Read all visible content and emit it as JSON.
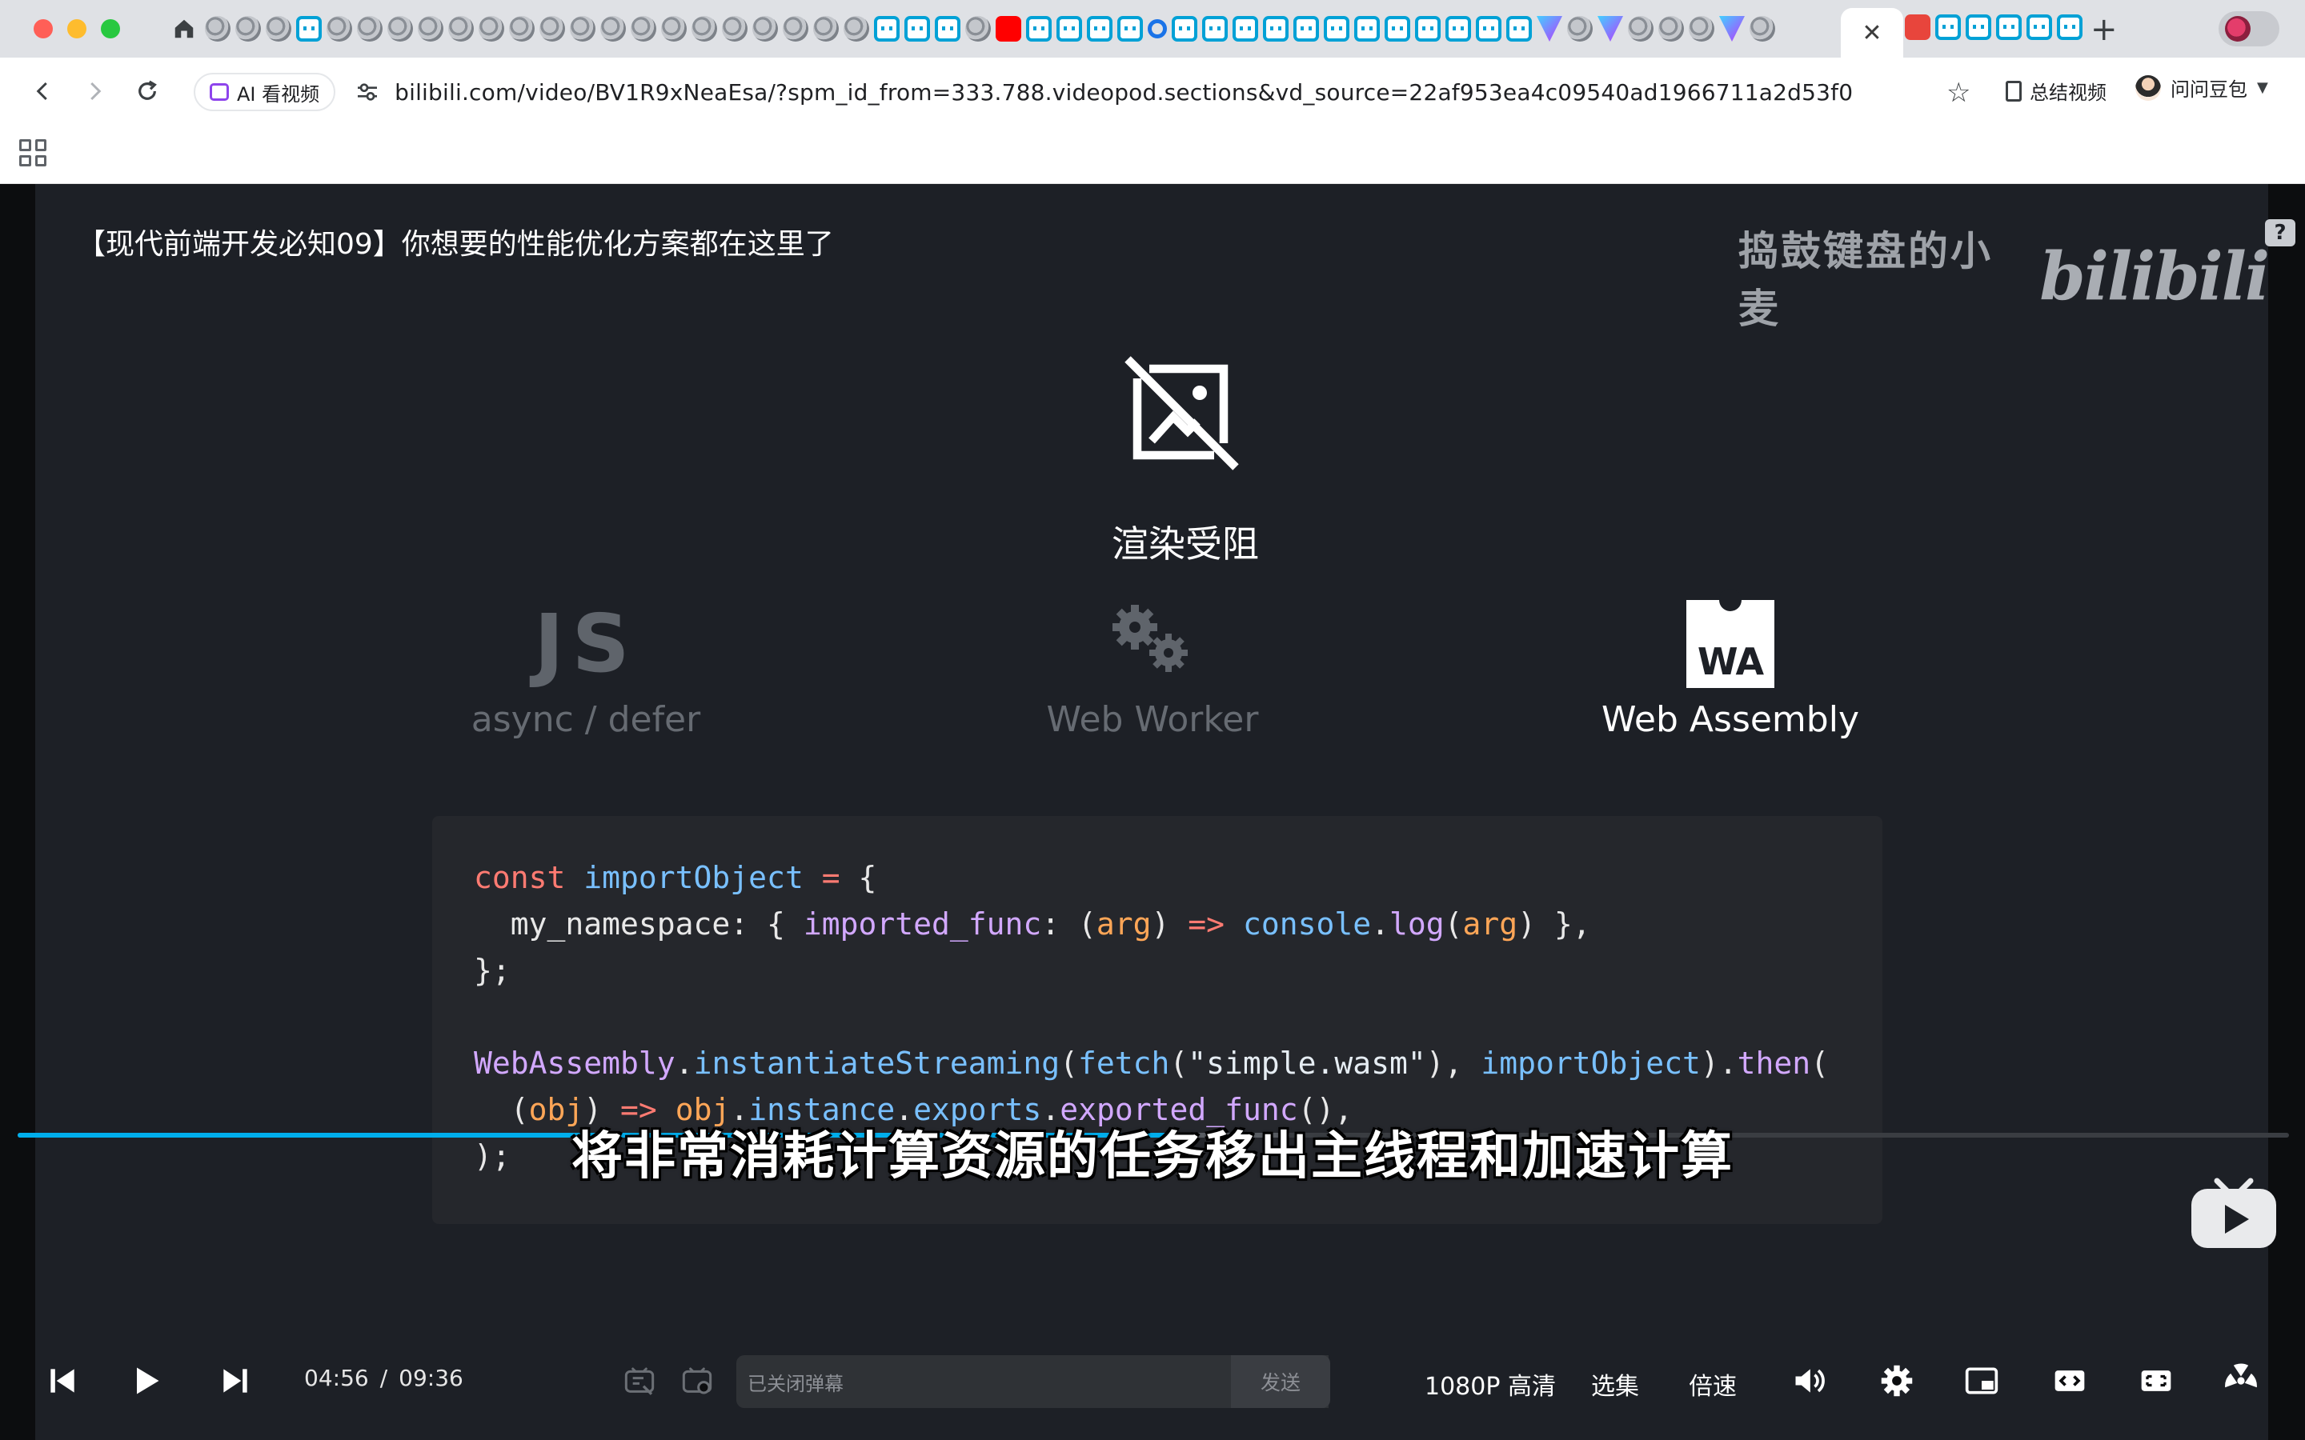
{
  "browser": {
    "active_tab_close": "✕",
    "new_tab": "+",
    "ai_chip_label": "AI 看视频",
    "url": "bilibili.com/video/BV1R9xNeaEsa/?spm_id_from=333.788.videopod.sections&vd_source=22af953ea4c09540ad1966711a2d53f0",
    "summary_label": "总结视频",
    "doubao_label": "问问豆包",
    "tab_icons": [
      "globe",
      "globe",
      "globe",
      "bili",
      "globe",
      "globe",
      "globe",
      "globe",
      "globe",
      "globe",
      "globe",
      "globe",
      "globe",
      "globe",
      "globe",
      "globe",
      "globe",
      "globe",
      "globe",
      "globe",
      "globe",
      "globe",
      "bili",
      "bili",
      "bili",
      "globe",
      "yt",
      "bili",
      "bili",
      "bili",
      "bili",
      "search",
      "bili",
      "bili",
      "bili",
      "bili",
      "bili",
      "bili",
      "bili",
      "bili",
      "bili",
      "bili",
      "bili",
      "bili",
      "vite",
      "globe",
      "vite",
      "globe",
      "globe",
      "globe",
      "vite",
      "globe"
    ],
    "tab_icons_after": [
      "dev",
      "bili",
      "bili",
      "bili",
      "bili",
      "bili"
    ]
  },
  "video": {
    "title": "【现代前端开发必知09】你想要的性能优化方案都在这里了",
    "watermark_name": "捣鼓键盘的小麦",
    "watermark_logo": "bilibili",
    "help_badge": "?",
    "blocked_label": "渲染受阻",
    "techs": [
      {
        "mark": "JS",
        "label": "async / defer",
        "state": "dim"
      },
      {
        "mark": "gears",
        "label": "Web Worker",
        "state": "dim"
      },
      {
        "mark": "WA",
        "label": "Web Assembly",
        "state": "bright"
      }
    ],
    "code_lines": [
      [
        [
          "kw",
          "const "
        ],
        [
          "var",
          "importObject"
        ],
        [
          "op",
          " = "
        ],
        [
          "plain",
          "{"
        ]
      ],
      [
        [
          "plain",
          "  my_namespace: { "
        ],
        [
          "prop",
          "imported_func"
        ],
        [
          "plain",
          ": ("
        ],
        [
          "param",
          "arg"
        ],
        [
          "plain",
          ") "
        ],
        [
          "op",
          "=>"
        ],
        [
          "plain",
          " "
        ],
        [
          "var",
          "console"
        ],
        [
          "plain",
          "."
        ],
        [
          "fn",
          "log"
        ],
        [
          "plain",
          "("
        ],
        [
          "param",
          "arg"
        ],
        [
          "plain",
          ") },"
        ]
      ],
      [
        [
          "plain",
          "};"
        ]
      ],
      [
        [
          "plain",
          ""
        ]
      ],
      [
        [
          "cls",
          "WebAssembly"
        ],
        [
          "plain",
          "."
        ],
        [
          "var",
          "instantiateStreaming"
        ],
        [
          "plain",
          "("
        ],
        [
          "var",
          "fetch"
        ],
        [
          "plain",
          "("
        ],
        [
          "str",
          "\"simple.wasm\""
        ],
        [
          "plain",
          "), "
        ],
        [
          "var",
          "importObject"
        ],
        [
          "plain",
          ")."
        ],
        [
          "fn",
          "then"
        ],
        [
          "plain",
          "("
        ]
      ],
      [
        [
          "plain",
          "  ("
        ],
        [
          "param",
          "obj"
        ],
        [
          "plain",
          ") "
        ],
        [
          "op",
          "=>"
        ],
        [
          "plain",
          " "
        ],
        [
          "param",
          "obj"
        ],
        [
          "plain",
          "."
        ],
        [
          "var",
          "instance"
        ],
        [
          "plain",
          "."
        ],
        [
          "var",
          "exports"
        ],
        [
          "plain",
          "."
        ],
        [
          "fn",
          "exported_func"
        ],
        [
          "plain",
          "(),"
        ]
      ],
      [
        [
          "plain",
          ");"
        ]
      ]
    ],
    "subtitle": "将非常消耗计算资源的任务移出主线程和加速计算"
  },
  "player": {
    "current_time": "04:56",
    "time_separator": "/",
    "duration": "09:36",
    "progress_played_fraction": 0.514,
    "progress_buffered_fraction": 0.56,
    "danmaku_placeholder": "已关闭弹幕",
    "send_label": "发送",
    "quality_label": "1080P 高清",
    "episodes_label": "选集",
    "speed_label": "倍速"
  },
  "colors": {
    "accent": "#00aeec",
    "slide_bg": "#1d2026",
    "code_bg": "#25272c"
  }
}
